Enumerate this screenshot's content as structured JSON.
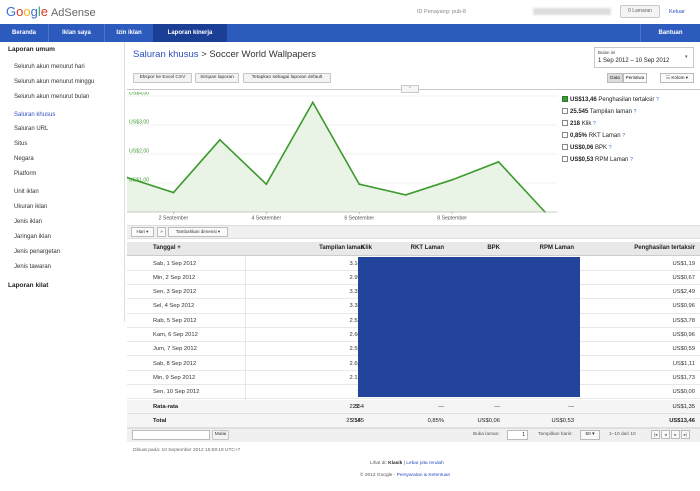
{
  "header": {
    "logo_google": [
      "G",
      "o",
      "o",
      "g",
      "l",
      "e"
    ],
    "logo_product": "AdSense",
    "publisher_id": "ID Penayang: pub-8",
    "messages_button": "0 Lamaran",
    "logout": "Keluar"
  },
  "nav": {
    "tabs": [
      "Beranda",
      "Iklan saya",
      "Izin iklan",
      "Laporan kinerja"
    ],
    "help": "Bantuan"
  },
  "sidebar": {
    "section1": "Laporan umum",
    "items1": [
      "Seluruh akun menurut hari",
      "Seluruh akun menurut minggu",
      "Seluruh akun menurut bulan"
    ],
    "items2": [
      "Saluran khusus",
      "Saluran URL",
      "Situs",
      "Negara",
      "Platform"
    ],
    "items3": [
      "Unit iklan",
      "Ukuran iklan",
      "Jenis iklan",
      "Jaringan iklan",
      "Jenis penargetan",
      "Jenis tawaran"
    ],
    "section2": "Laporan kilat"
  },
  "report": {
    "breadcrumb_link": "Saluran khusus",
    "breadcrumb_sep": ">",
    "breadcrumb_current": "Soccer World Wallpapers",
    "buttons": [
      "Ekspor ke Excel CSV",
      "Simpan laporan",
      "Tetapkan sebagai laporan default"
    ],
    "date_label": "Bulan ini",
    "date_value": "1 Sep 2012 – 10 Sep 2012",
    "view_toggle": [
      "Data",
      "Peristiwa"
    ],
    "columns_button": "☷ Kolom ▾"
  },
  "legend": [
    {
      "value": "US$13,46",
      "label": "Penghasilan tertaksir",
      "checked": true
    },
    {
      "value": "25.545",
      "label": "Tampilan laman",
      "checked": false
    },
    {
      "value": "218",
      "label": "Klik",
      "checked": false
    },
    {
      "value": "0,85%",
      "label": "RKT Laman",
      "checked": false
    },
    {
      "value": "US$0,06",
      "label": "BPK",
      "checked": false
    },
    {
      "value": "US$0,53",
      "label": "RPM Laman",
      "checked": false
    }
  ],
  "chart_data": {
    "type": "area",
    "series": [
      {
        "name": "Penghasilan tertaksir",
        "values": [
          1.19,
          0.67,
          2.49,
          0.96,
          3.78,
          0.96,
          0.59,
          1.11,
          1.73,
          0.0
        ]
      }
    ],
    "x": [
      "1 Sep",
      "2 Sep",
      "3 Sep",
      "4 Sep",
      "5 Sep",
      "6 Sep",
      "7 Sep",
      "8 Sep",
      "9 Sep",
      "10 Sep"
    ],
    "ytick_labels": [
      "US$1,00",
      "US$2,00",
      "US$3,00",
      "US$4,00"
    ],
    "yticks": [
      1,
      2,
      3,
      4
    ],
    "xtick_labels": [
      "2 September",
      "4 September",
      "6 September",
      "8 September"
    ],
    "ylim": [
      0,
      4
    ],
    "color": "#3c9a2e",
    "fill": "#e9f3e6"
  },
  "dims": {
    "day_button": "Hari ▾",
    "arrow": "»",
    "add_dim_button": "Tambahkan dimensi ▾"
  },
  "table": {
    "headers": [
      "Tanggal +",
      "Tampilan laman",
      "Klik",
      "RKT Laman",
      "BPK",
      "RPM Laman",
      "Penghasilan tertaksir"
    ],
    "rows": [
      {
        "date": "Sab, 1 Sep 2012",
        "views": "3.145",
        "earn": "US$1,19"
      },
      {
        "date": "Min, 2 Sep 2012",
        "views": "2.990",
        "earn": "US$0,67"
      },
      {
        "date": "Sen, 3 Sep 2012",
        "views": "3.359",
        "earn": "US$2,49"
      },
      {
        "date": "Sel, 4 Sep 2012",
        "views": "3.387",
        "earn": "US$0,96"
      },
      {
        "date": "Rab, 5 Sep 2012",
        "views": "2.530",
        "earn": "US$3,78"
      },
      {
        "date": "Kam, 6 Sep 2012",
        "views": "2.608",
        "earn": "US$0,96"
      },
      {
        "date": "Jum, 7 Sep 2012",
        "views": "2.595",
        "earn": "US$0,59"
      },
      {
        "date": "Sab, 8 Sep 2012",
        "views": "2.655",
        "earn": "US$1,11"
      },
      {
        "date": "Min, 9 Sep 2012",
        "views": "2.177",
        "earn": "US$1,73"
      },
      {
        "date": "Sen, 10 Sep 2012",
        "views": "99",
        "earn": "US$0,00"
      }
    ],
    "avg": {
      "label": "Rata-rata",
      "views": "2.554",
      "clicks": "21",
      "ctr": "—",
      "cpc": "—",
      "rpm": "—",
      "earn": "US$1,35"
    },
    "total": {
      "label": "Total",
      "views": "25.545",
      "clicks": "218",
      "ctr": "0,85%",
      "cpc": "US$0,06",
      "rpm": "US$0,53",
      "earn": "US$13,46"
    }
  },
  "pager": {
    "filter_button": "Mulai",
    "go_label": "Buka laman:",
    "go_value": "1",
    "rows_label": "Tampilkan baris:",
    "rows_value": "50 ▾",
    "range": "1–10 dari 10"
  },
  "footer": {
    "generated": "Dibuat pada: 10 September 2012 15:59:18 UTC+7",
    "view_in": "Lihat di:",
    "classic": "Klasik",
    "sep": "|",
    "low_bw": "Lebar pita rendah",
    "copyright": "© 2012 Google -",
    "terms": "Persyaratan & Ketentuan"
  }
}
